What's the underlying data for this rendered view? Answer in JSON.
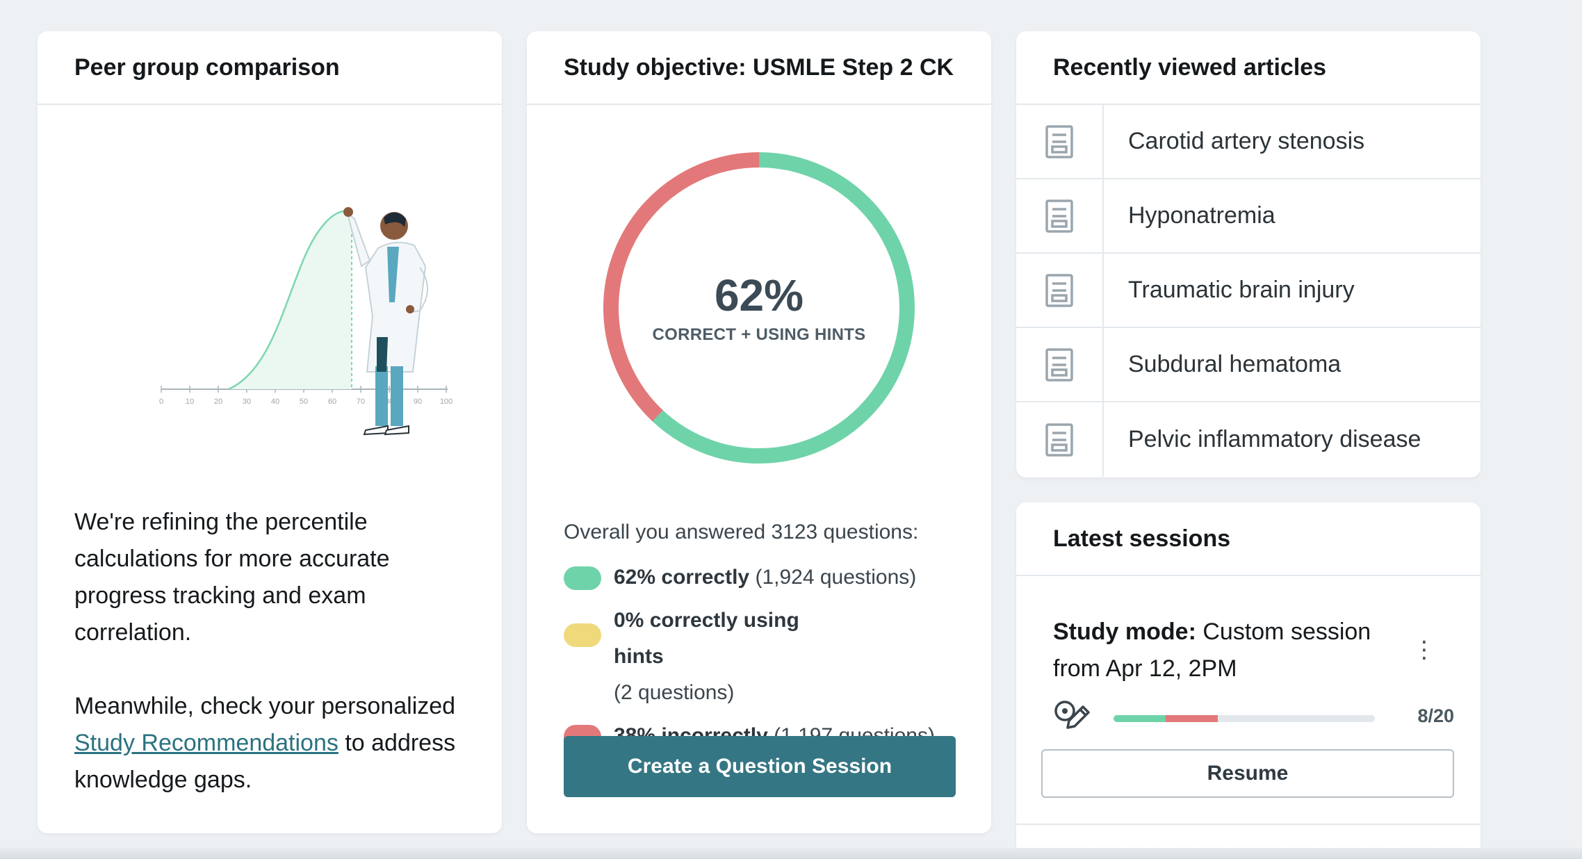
{
  "peer": {
    "title": "Peer group comparison",
    "axis_ticks": [
      "0",
      "10",
      "20",
      "30",
      "40",
      "50",
      "60",
      "70",
      "80",
      "90",
      "100"
    ],
    "paragraph1": "We're refining the percentile calculations for more accurate progress tracking and exam correlation.",
    "paragraph2_before": "Meanwhile, check your personalized ",
    "paragraph2_link": "Study Recommendations",
    "paragraph2_after": " to address knowledge gaps."
  },
  "study": {
    "title": "Study objective: USMLE Step 2 CK",
    "donut_percent": "62%",
    "donut_label": "CORRECT + USING HINTS",
    "donut_correct_fraction": 0.62,
    "donut_incorrect_fraction": 0.38,
    "overall_text": "Overall you answered 3123 questions:",
    "legend": [
      {
        "bold": "62% correctly",
        "rest": " (1,924 questions)",
        "color": "#6fd3aa"
      },
      {
        "bold": "0% correctly using hints",
        "rest": "(2 questions)",
        "color": "#f0d97b"
      },
      {
        "bold": "38% incorrectly",
        "rest": " (1,197 questions)",
        "color": "#e3787a"
      }
    ],
    "create_button": "Create a Question Session"
  },
  "articles": {
    "title": "Recently viewed articles",
    "items": [
      {
        "label": "Carotid artery stenosis",
        "icon": "document-icon"
      },
      {
        "label": "Hyponatremia",
        "icon": "document-icon"
      },
      {
        "label": "Traumatic brain injury",
        "icon": "document-icon"
      },
      {
        "label": "Subdural hematoma",
        "icon": "document-icon"
      },
      {
        "label": "Pelvic inflammatory disease",
        "icon": "document-icon"
      }
    ]
  },
  "sessions": {
    "title": "Latest sessions",
    "mode_label": "Study mode:",
    "mode_value": " Custom session from Apr 12, 2PM",
    "kebab": "⋮",
    "progress_count": "8/20",
    "progress_correct_fraction": 0.2,
    "progress_incorrect_fraction": 0.2,
    "resume_button": "Resume"
  },
  "colors": {
    "correct": "#6fd3aa",
    "incorrect": "#e3787a",
    "hints": "#f0d97b",
    "primary": "#357684",
    "link": "#2b7280"
  }
}
